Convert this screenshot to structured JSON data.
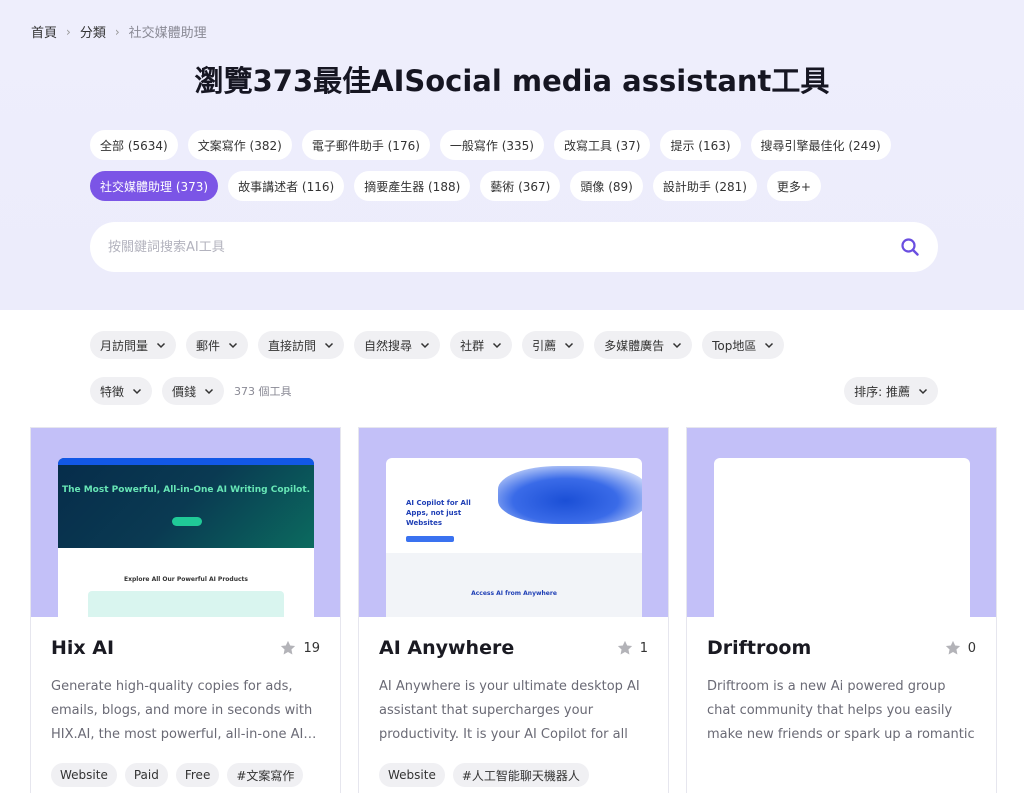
{
  "breadcrumb": {
    "home": "首頁",
    "category": "分類",
    "current": "社交媒體助理"
  },
  "page_title": "瀏覽373最佳AISocial media assistant工具",
  "category_chips_row1": [
    "全部 (5634)",
    "文案寫作 (382)",
    "電子郵件助手 (176)",
    "一般寫作 (335)",
    "改寫工具 (37)",
    "提示 (163)",
    "搜尋引擎最佳化 (249)"
  ],
  "category_chips_row2": [
    "社交媒體助理 (373)",
    "故事講述者 (116)",
    "摘要產生器 (188)",
    "藝術 (367)",
    "頭像 (89)",
    "設計助手 (281)",
    "更多+"
  ],
  "active_chip": "社交媒體助理 (373)",
  "search": {
    "placeholder": "按關鍵詞搜索AI工具",
    "value": ""
  },
  "filters_row1": [
    "月訪問量",
    "郵件",
    "直接訪問",
    "自然搜尋",
    "社群",
    "引薦",
    "多媒體廣告",
    "Top地區"
  ],
  "filters_row2": [
    "特徵",
    "價錢"
  ],
  "tool_count": "373 個工具",
  "sort_label": "排序: 推薦",
  "colors": {
    "accent": "#7b55e6",
    "hero_bg": "#ececfb",
    "thumb_bg": "#c3c0f8"
  },
  "cards": [
    {
      "name": "Hix AI",
      "favorites": "19",
      "description": "Generate high-quality copies for ads, emails, blogs, and more in seconds with HIX.AI, the most powerful, all-in-one AI…",
      "tags": [
        "Website",
        "Paid",
        "Free",
        "#文案寫作"
      ],
      "shot_headline": "The Most Powerful, All-in-One AI Writing Copilot.",
      "shot_section": "Explore All Our Powerful AI Products"
    },
    {
      "name": "AI Anywhere",
      "favorites": "1",
      "description": "AI Anywhere is your ultimate desktop AI assistant that supercharges your productivity. It is your AI Copilot for all app…",
      "tags": [
        "Website",
        "#人工智能聊天機器人"
      ],
      "shot_headline": "AI Copilot for All Apps, not just Websites",
      "shot_section": "Access AI from Anywhere"
    },
    {
      "name": "Driftroom",
      "favorites": "0",
      "description": "Driftroom is a new Ai powered group chat community that helps you easily make new friends or spark up a romantic encounter!…",
      "tags": []
    }
  ]
}
